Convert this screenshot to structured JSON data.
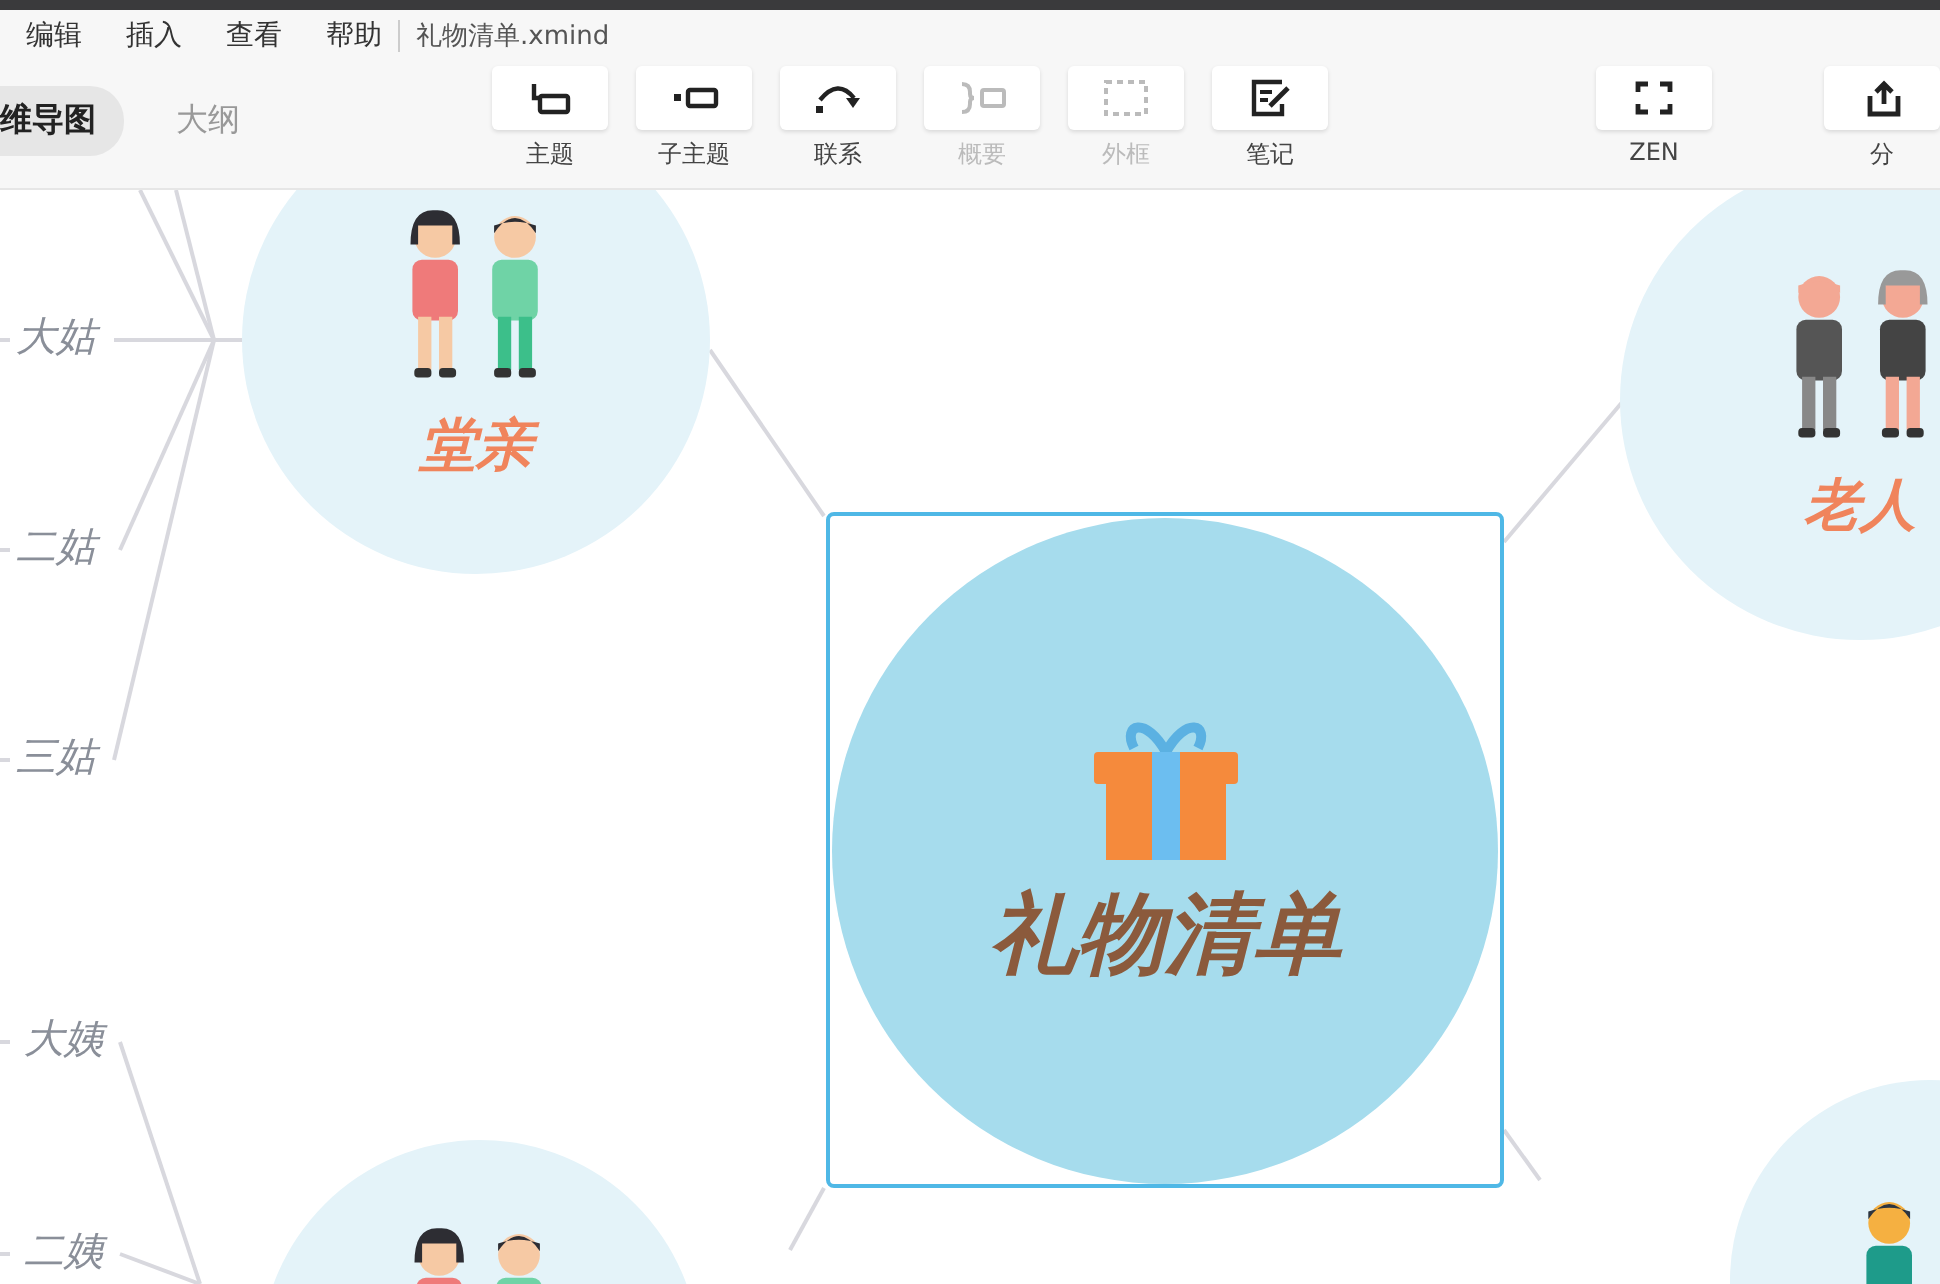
{
  "menu": [
    {
      "label": "编辑"
    },
    {
      "label": "插入"
    },
    {
      "label": "查看"
    },
    {
      "label": "帮助"
    }
  ],
  "file_name": "礼物清单.xmind",
  "view_tabs": [
    {
      "label": "维导图",
      "selected": true
    },
    {
      "label": "大纲",
      "selected": false
    }
  ],
  "toolbar": {
    "edit_tools": [
      {
        "label": "主题",
        "kind": "topic",
        "disabled": false
      },
      {
        "label": "子主题",
        "kind": "subtopic",
        "disabled": false
      },
      {
        "label": "联系",
        "kind": "relation",
        "disabled": false
      },
      {
        "label": "概要",
        "kind": "summary",
        "disabled": true
      },
      {
        "label": "外框",
        "kind": "boundary",
        "disabled": true
      },
      {
        "label": "笔记",
        "kind": "note",
        "disabled": false
      }
    ],
    "view_tools": [
      {
        "label": "ZEN",
        "kind": "zen",
        "disabled": false
      }
    ],
    "share_tools": [
      {
        "label": "分",
        "kind": "share",
        "disabled": false
      }
    ]
  },
  "mind_map": {
    "central_topic": {
      "label": "礼物清单",
      "selected": true
    },
    "branches": [
      {
        "label": "堂亲",
        "kind": "kids",
        "children": [
          {
            "label": "大姑"
          },
          {
            "label": "二姑"
          },
          {
            "label": "三姑"
          }
        ]
      },
      {
        "label": "老人",
        "kind": "elders"
      },
      {
        "kind": "kids",
        "children": [
          {
            "label": "大姨"
          },
          {
            "label": "二姨"
          }
        ]
      },
      {
        "kind": "adults"
      }
    ]
  }
}
